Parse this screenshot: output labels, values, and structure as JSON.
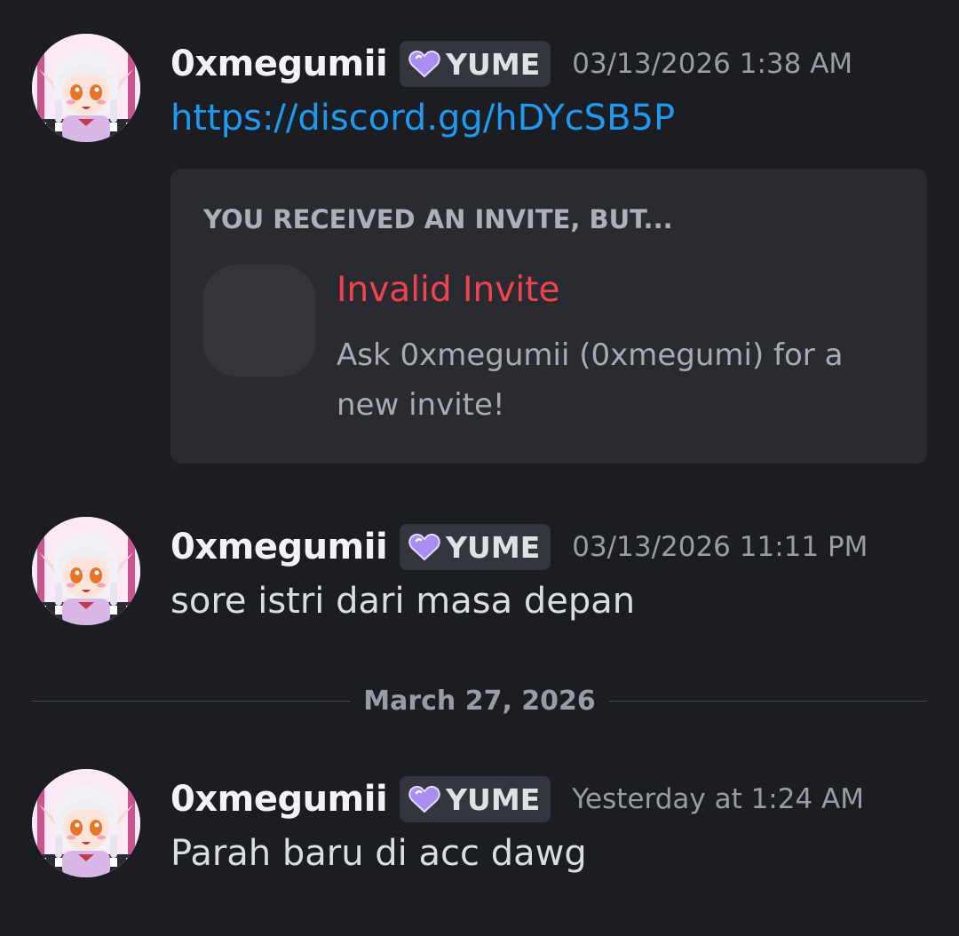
{
  "messages": [
    {
      "username": "0xmegumii",
      "tag": "YUME",
      "timestamp": "03/13/2026 1:38 AM",
      "link": "https://discord.gg/hDYcSB5P",
      "embed": {
        "title": "YOU RECEIVED AN INVITE, BUT...",
        "heading": "Invalid Invite",
        "description": "Ask 0xmegumii (0xmegumi) for a new invite!"
      }
    },
    {
      "username": "0xmegumii",
      "tag": "YUME",
      "timestamp": "03/13/2026 11:11 PM",
      "text": "sore istri dari masa depan"
    },
    {
      "username": "0xmegumii",
      "tag": "YUME",
      "timestamp": "Yesterday at 1:24 AM",
      "text": "Parah baru di acc dawg"
    }
  ],
  "date_divider": "March 27, 2026",
  "icons": {
    "avatar": "anime-avatar-icon",
    "tag": "purple-heart-icon"
  },
  "colors": {
    "background": "#1c1d22",
    "link": "#1e9af0",
    "invalid": "#f1434f",
    "embed_bg": "#2a2b31"
  }
}
